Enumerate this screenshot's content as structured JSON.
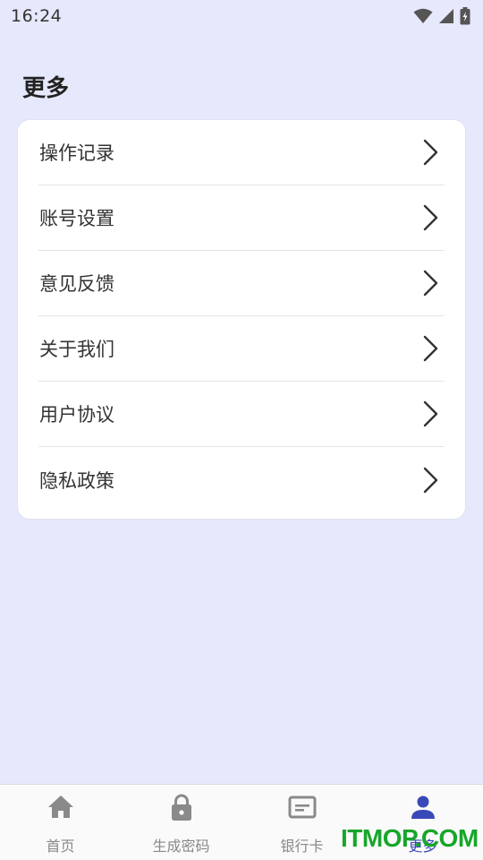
{
  "status_bar": {
    "time": "16:24"
  },
  "page": {
    "title": "更多"
  },
  "menu": {
    "items": [
      {
        "label": "操作记录"
      },
      {
        "label": "账号设置"
      },
      {
        "label": "意见反馈"
      },
      {
        "label": "关于我们"
      },
      {
        "label": "用户协议"
      },
      {
        "label": "隐私政策"
      }
    ]
  },
  "tab_bar": {
    "tabs": [
      {
        "label": "首页",
        "icon": "home-icon",
        "active": false
      },
      {
        "label": "生成密码",
        "icon": "lock-icon",
        "active": false
      },
      {
        "label": "银行卡",
        "icon": "card-icon",
        "active": false
      },
      {
        "label": "更多",
        "icon": "person-icon",
        "active": true
      }
    ]
  },
  "watermark": {
    "text": "ITMOP.COM"
  },
  "colors": {
    "background": "#e6e8fb",
    "active_tab": "#3a49b8",
    "inactive_tab": "#888888",
    "watermark": "#17a62a"
  }
}
